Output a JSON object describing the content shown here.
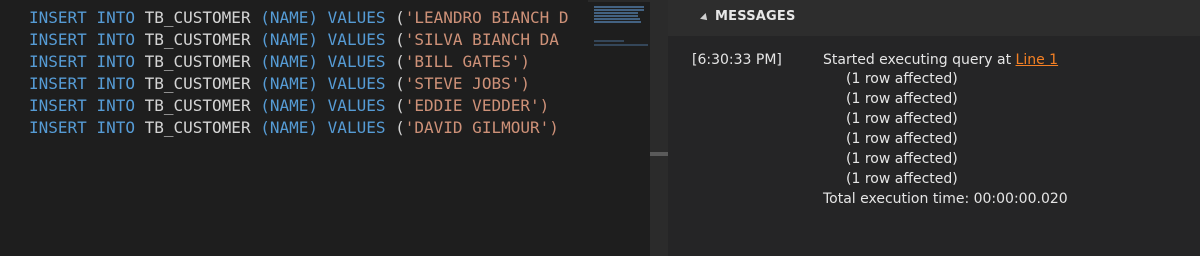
{
  "editor": {
    "lines": [
      {
        "kw1": "INSERT",
        "kw2": "INTO",
        "table": "TB_CUSTOMER",
        "col_open": "(",
        "column": "NAME",
        "col_close": ")",
        "kw3": "VALUES",
        "paren": "(",
        "value": "'LEANDRO BIANCH D"
      },
      {
        "kw1": "INSERT",
        "kw2": "INTO",
        "table": "TB_CUSTOMER",
        "col_open": "(",
        "column": "NAME",
        "col_close": ")",
        "kw3": "VALUES",
        "paren": "(",
        "value": "'SILVA BIANCH DA "
      },
      {
        "kw1": "INSERT",
        "kw2": "INTO",
        "table": "TB_CUSTOMER",
        "col_open": "(",
        "column": "NAME",
        "col_close": ")",
        "kw3": "VALUES",
        "paren": "(",
        "value": "'BILL GATES')"
      },
      {
        "kw1": "INSERT",
        "kw2": "INTO",
        "table": "TB_CUSTOMER",
        "col_open": "(",
        "column": "NAME",
        "col_close": ")",
        "kw3": "VALUES",
        "paren": "(",
        "value": "'STEVE JOBS')"
      },
      {
        "kw1": "INSERT",
        "kw2": "INTO",
        "table": "TB_CUSTOMER",
        "col_open": "(",
        "column": "NAME",
        "col_close": ")",
        "kw3": "VALUES",
        "paren": "(",
        "value": "'EDDIE VEDDER')"
      },
      {
        "kw1": "INSERT",
        "kw2": "INTO",
        "table": "TB_CUSTOMER",
        "col_open": "(",
        "column": "NAME",
        "col_close": ")",
        "kw3": "VALUES",
        "paren": "(",
        "value": "'DAVID GILMOUR')"
      }
    ]
  },
  "messages": {
    "header": "MESSAGES",
    "timestamp": "[6:30:33 PM]",
    "started_prefix": "Started executing query at ",
    "line_link": "Line 1",
    "rows": [
      "(1 row affected)",
      "(1 row affected)",
      "(1 row affected)",
      "(1 row affected)",
      "(1 row affected)",
      "(1 row affected)"
    ],
    "total": "Total execution time: 00:00:00.020"
  },
  "colors": {
    "keyword": "#569cd6",
    "string": "#ce9178",
    "link": "#f48024"
  }
}
